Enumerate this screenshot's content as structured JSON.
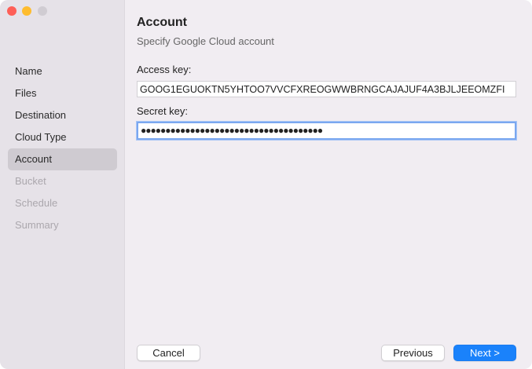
{
  "window": {
    "colors": {
      "close": "#fe5f57",
      "minimize": "#febc2e",
      "zoom": "#d0ccd2",
      "accent": "#1a82fb"
    }
  },
  "sidebar": {
    "items": [
      {
        "label": "Name",
        "state": "done"
      },
      {
        "label": "Files",
        "state": "done"
      },
      {
        "label": "Destination",
        "state": "done"
      },
      {
        "label": "Cloud Type",
        "state": "done"
      },
      {
        "label": "Account",
        "state": "selected"
      },
      {
        "label": "Bucket",
        "state": "disabled"
      },
      {
        "label": "Schedule",
        "state": "disabled"
      },
      {
        "label": "Summary",
        "state": "disabled"
      }
    ]
  },
  "main": {
    "title": "Account",
    "subtitle": "Specify Google Cloud account",
    "access_key_label": "Access key:",
    "access_key_value": "GOOG1EGUOKTN5YHTOO7VVCFXREOGWWBRNGCAJAJUF4A3BJLJEEOMZFI",
    "secret_key_label": "Secret key:",
    "secret_key_value": "●●●●●●●●●●●●●●●●●●●●●●●●●●●●●●●●●●●●●"
  },
  "footer": {
    "cancel": "Cancel",
    "previous": "Previous",
    "next": "Next >"
  }
}
